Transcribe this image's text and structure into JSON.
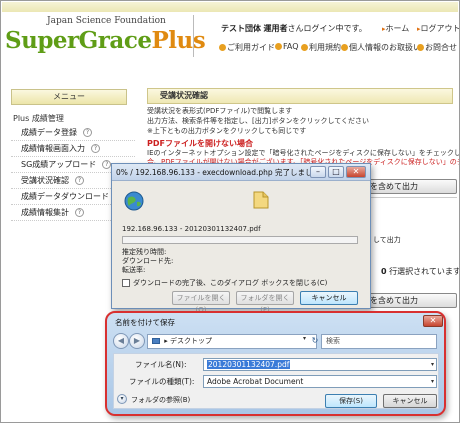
{
  "header": {
    "org_name": "Japan Science Foundation",
    "logo_main": "SuperGrace",
    "logo_plus": "Plus",
    "user_group": "テスト団体",
    "user_name": "運用者",
    "login_suffix": "さんログイン中です。",
    "home": "ホーム",
    "logout": "ログアウト",
    "nav": [
      "ご利用ガイド",
      "FAQ",
      "利用規約",
      "個人情報のお取扱い",
      "お問合せ"
    ]
  },
  "sidebar": {
    "title": "メニュー",
    "section": "Plus 成績管理",
    "items": [
      "成績データ登録",
      "成績情報画面入力",
      "SG成績アップロード",
      "受講状況確認",
      "成績データダウンロード",
      "成績情報集計"
    ],
    "help_glyph": "?"
  },
  "main": {
    "title": "受講状況確認",
    "lines": [
      "受講状況を表形式(PDFファイル)で閲覧します",
      "出力方法、検索条件等を指定し、[出力]ボタンをクリックしてください",
      "※上下ともの出力ボタンをクリックしても同じです"
    ],
    "warn_title": "PDFファイルを開けない場合",
    "warn_lines": [
      "IEのインターネットオプション設定で「暗号化されたページをディスクに保存しない」をチェックしている場",
      "合、PDFファイルが開けない場合がございます。「暗号化されたページをディスクに保存しない」のチェッ"
    ],
    "output_button": "を含めて出力",
    "bg_output_text": "して出力",
    "count_value": "0",
    "count_text": "行選択されています。"
  },
  "download_dialog": {
    "title": "0% / 192.168.96.133 - execdownload.php 完了しました",
    "minimize": "–",
    "maximize": "□",
    "close": "✕",
    "file": "192.168.96.133 - 20120301132407.pdf",
    "progress": 0,
    "labels": [
      "推定残り時間:",
      "ダウンロード先:",
      "転送率:"
    ],
    "checkbox_label": "ダウンロードの完了後、このダイアログ ボックスを閉じる(C)",
    "open_file": "ファイルを開く(O)",
    "open_folder": "フォルダを開く(F)",
    "cancel": "キャンセル"
  },
  "save_dialog": {
    "title": "名前を付けて保存",
    "close": "✕",
    "back": "◀",
    "forward": "▶",
    "location": "デスクトップ",
    "location_arrow": "▸",
    "refresh": "↻",
    "search_placeholder": "検索",
    "filename_label": "ファイル名(N):",
    "filename_value": "20120301132407.pdf",
    "filetype_label": "ファイルの種類(T):",
    "filetype_value": "Adobe Acrobat Document",
    "browse_folders": "フォルダの参照(B)",
    "save": "保存(S)",
    "cancel": "キャンセル"
  }
}
